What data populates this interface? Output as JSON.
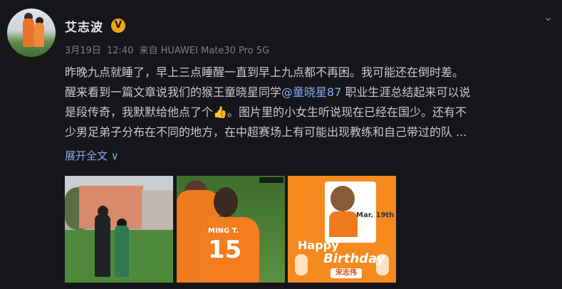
{
  "post": {
    "username": "艾志波",
    "verified_badge": "V",
    "meta": {
      "date": "3月19日",
      "time": "12:40",
      "source_prefix": "来自",
      "device": "HUAWEI Mate30 Pro 5G"
    },
    "content": {
      "line1": "昨晚九点就睡了，早上三点睡醒一直到早上九点都不再困。我可能还在倒时差。",
      "line2_before_mention": "醒来看到一篇文章说我们的猴王童晓星同学",
      "mention": "@童晓星87",
      "line2_after_mention": " 职业生涯总结起来可以说",
      "line3_before_thumb": "是段传奇，我默默给他点了个",
      "thumb": "👍",
      "line3_after_thumb": "。图片里的小女生听说现在已经在国少。还有不",
      "line4": "少男足弟子分布在不同的地方，在中超赛场上有可能出现教练和自己带过的队 ..."
    },
    "expand_label": "展开全文 ∨",
    "icons": {
      "verified": "verified-badge-icon",
      "menu": "chevron-down-icon"
    },
    "photos": [
      {
        "name": "photo-coach-and-girl"
      },
      {
        "name": "photo-match-players",
        "jersey_name": "MING T.",
        "jersey_number": "15"
      },
      {
        "name": "photo-birthday-card",
        "text_happy": "Happy",
        "text_birthday": "Birthday",
        "date": "Mar. 19th",
        "cn_name": "宋志伟"
      }
    ],
    "colors": {
      "background": "#16161a",
      "link": "#8aa8f0",
      "badge": "#f3a614"
    }
  }
}
